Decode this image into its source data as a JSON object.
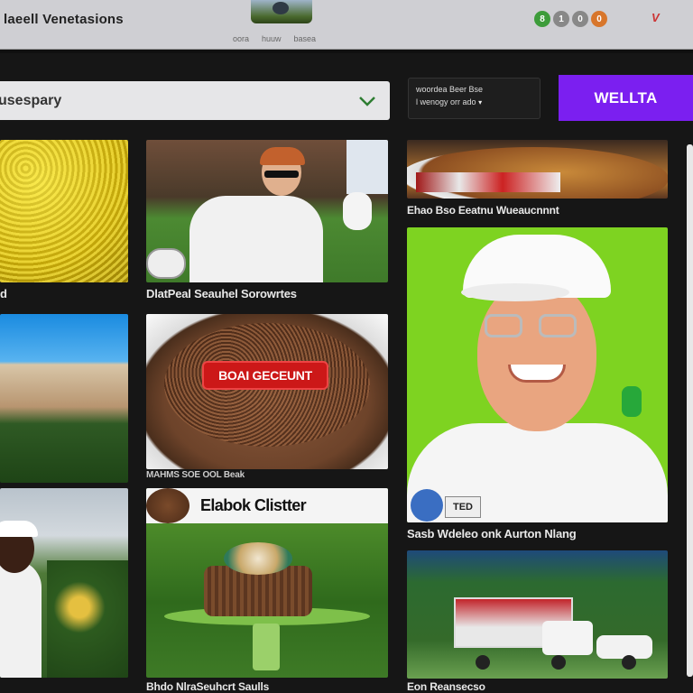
{
  "header": {
    "title": "laeell Venetasions",
    "links": [
      "oora",
      "huuw",
      "basea"
    ],
    "badges": [
      "8",
      "1",
      "0",
      "0"
    ],
    "brand": "V",
    "accent_color": "#7b1ff0"
  },
  "toolbar": {
    "dropdown_value": "usespary",
    "filter_line1": "woordea Beer Bse",
    "filter_line2": "l wenogy orr ado",
    "primary_button": "WELLTA"
  },
  "cards": [
    {
      "id": "yellow-flowers",
      "caption": "d"
    },
    {
      "id": "golfer",
      "caption": "DlatPeal Seauhel Sorowrtes"
    },
    {
      "id": "food-plate",
      "caption": "Ehao Bso Eeatnu Wueaucnnnt"
    },
    {
      "id": "mountain",
      "caption": ""
    },
    {
      "id": "granola",
      "caption": "MAHMS SOE OOL Beak",
      "label": "BOAI GECEUNT"
    },
    {
      "id": "portrait",
      "caption": "Sasb Wdeleo onk Aurton Nlang",
      "tag": "TED"
    },
    {
      "id": "golfer-2",
      "caption": ""
    },
    {
      "id": "cake",
      "caption": "Bhdo NlraSeuhcrt Saulls",
      "banner": "Elabok Clistter"
    },
    {
      "id": "truck",
      "caption": "Eon Reansecso"
    }
  ]
}
